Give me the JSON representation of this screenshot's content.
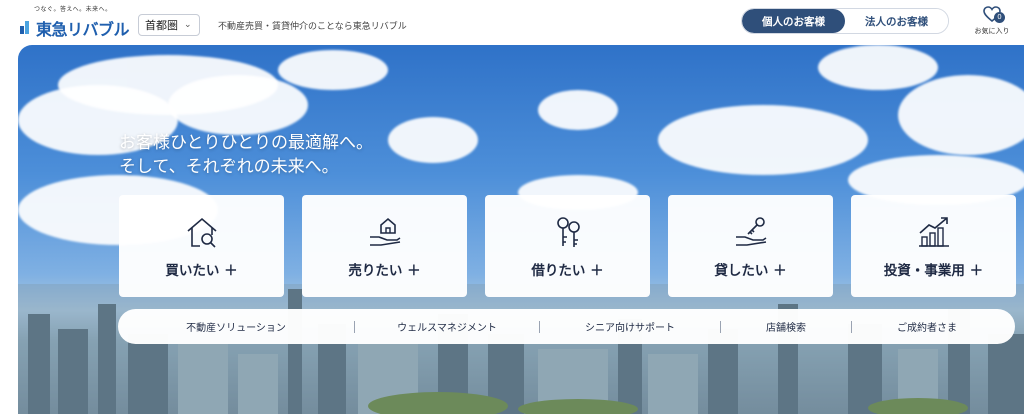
{
  "header": {
    "logo_tagline": "つなぐ。答えへ。未来へ。",
    "logo_text": "東急リバブル",
    "region": "首都圏",
    "tagline": "不動産売買・賃貸仲介のことなら東急リバブル",
    "segments": [
      "個人のお客様",
      "法人のお客様"
    ],
    "favorites_count": "0",
    "favorites_label": "お気に入り"
  },
  "hero": {
    "headline_line1": "お客様ひとりひとりの最適解へ。",
    "headline_line2": "そして、それぞれの未来へ。",
    "cards": [
      {
        "label": "買いたい ＋",
        "icon": "house-search-icon"
      },
      {
        "label": "売りたい ＋",
        "icon": "hand-house-icon"
      },
      {
        "label": "借りたい ＋",
        "icon": "keys-icon"
      },
      {
        "label": "貸したい ＋",
        "icon": "hand-key-icon"
      },
      {
        "label": "投資・事業用 ＋",
        "icon": "growth-chart-icon"
      }
    ],
    "subnav": [
      "不動産ソリューション",
      "ウェルスマネジメント",
      "シニア向けサポート",
      "店舗検索",
      "ご成約者さま"
    ]
  },
  "colors": {
    "brand_blue": "#1f5fae",
    "active_segment": "#2f4f7a"
  }
}
